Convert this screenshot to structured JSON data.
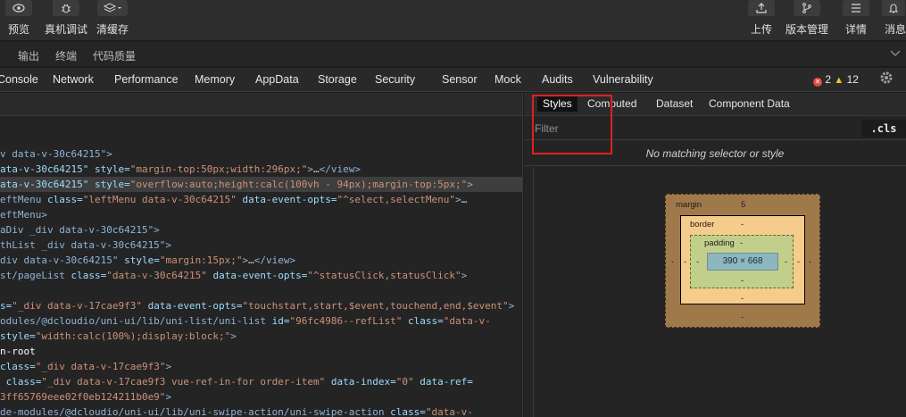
{
  "toolbar": {
    "left_buttons": [
      {
        "label": "预览",
        "icon": "eye-icon"
      },
      {
        "label": "真机调试",
        "icon": "bug-icon"
      },
      {
        "label": "清缓存",
        "icon": "layers-icon"
      }
    ],
    "right_buttons": [
      {
        "label": "上传",
        "icon": "upload-icon"
      },
      {
        "label": "版本管理",
        "icon": "branch-icon"
      },
      {
        "label": "详情",
        "icon": "menu-icon"
      },
      {
        "label": "消息",
        "icon": "bell-icon"
      }
    ]
  },
  "subtabs": [
    "输出",
    "终端",
    "代码质量"
  ],
  "devtools": {
    "tabs": [
      "Console",
      "Network",
      "Performance",
      "Memory",
      "AppData",
      "Storage",
      "Security",
      "Sensor",
      "Mock",
      "Audits",
      "Vulnerability"
    ],
    "error_count": "2",
    "warning_count": "12"
  },
  "styles_panel": {
    "tabs": [
      "Styles",
      "Computed",
      "Dataset",
      "Component Data"
    ],
    "active_tab": "Styles",
    "filter_placeholder": "Filter",
    "cls_label": ".cls",
    "no_match": "No matching selector or style"
  },
  "box_model": {
    "margin_label": "margin",
    "margin_top": "5",
    "margin_left": "-",
    "margin_right": "-",
    "margin_bottom": "-",
    "border_label": "border",
    "border_top": "-",
    "border_left": "-",
    "border_right": "-",
    "border_bottom": "-",
    "padding_label": "padding",
    "padding_top": "-",
    "padding_left": "-",
    "padding_right": "-",
    "padding_bottom": "-",
    "content": "390 × 668"
  },
  "elements": {
    "lines": [
      [
        {
          "c": "tag",
          "t": "v data-v-30c64215\">"
        }
      ],
      [
        {
          "c": "at",
          "t": "ata-v-30c64215\" "
        },
        {
          "c": "at",
          "t": "style="
        },
        {
          "c": "av",
          "t": "\"margin-top:50px;width:296px;\""
        },
        {
          "c": "tag",
          "t": ">"
        },
        {
          "c": "tx",
          "t": "…"
        },
        {
          "c": "tag",
          "t": "</view>"
        }
      ],
      [
        {
          "c": "at",
          "t": "ata-v-30c64215\" "
        },
        {
          "c": "at",
          "t": "style="
        },
        {
          "c": "av",
          "t": "\"overflow:auto;height:calc(100vh - 94px);margin-top:5px;\""
        },
        {
          "c": "tag",
          "t": ">"
        }
      ],
      [
        {
          "c": "tag",
          "t": "eftMenu "
        },
        {
          "c": "at",
          "t": "class="
        },
        {
          "c": "av",
          "t": "\"leftMenu data-v-30c64215\" "
        },
        {
          "c": "at",
          "t": "data-event-opts="
        },
        {
          "c": "av",
          "t": "\"^select,selectMenu\""
        },
        {
          "c": "tag",
          "t": ">"
        },
        {
          "c": "tx",
          "t": "…"
        }
      ],
      [
        {
          "c": "tag",
          "t": "eftMenu>"
        }
      ],
      [
        {
          "c": "tag",
          "t": "aDiv _div data-v-30c64215\">"
        }
      ],
      [
        {
          "c": "tag",
          "t": "thList _div data-v-30c64215\">"
        }
      ],
      [
        {
          "c": "tag",
          "t": "div data-v-30c64215\" "
        },
        {
          "c": "at",
          "t": "style="
        },
        {
          "c": "av",
          "t": "\"margin:15px;\""
        },
        {
          "c": "tag",
          "t": ">"
        },
        {
          "c": "tx",
          "t": "…"
        },
        {
          "c": "tag",
          "t": "</view>"
        }
      ],
      [
        {
          "c": "tag",
          "t": "st/pageList "
        },
        {
          "c": "at",
          "t": "class="
        },
        {
          "c": "av",
          "t": "\"data-v-30c64215\" "
        },
        {
          "c": "at",
          "t": "data-event-opts="
        },
        {
          "c": "av",
          "t": "\"^statusClick,statusClick\""
        },
        {
          "c": "tag",
          "t": ">"
        }
      ],
      [],
      [
        {
          "c": "at",
          "t": "s="
        },
        {
          "c": "av",
          "t": "\"_div data-v-17cae9f3\" "
        },
        {
          "c": "at",
          "t": "data-event-opts="
        },
        {
          "c": "av",
          "t": "\"touchstart,start,$event,touchend,end,$event\""
        },
        {
          "c": "tag",
          "t": ">"
        }
      ],
      [
        {
          "c": "tag",
          "t": "odules/@dcloudio/uni-ui/lib/uni-list/uni-list "
        },
        {
          "c": "at",
          "t": "id="
        },
        {
          "c": "av",
          "t": "\"96fc4986--refList\" "
        },
        {
          "c": "at",
          "t": "class="
        },
        {
          "c": "av",
          "t": "\"data-v-"
        }
      ],
      [
        {
          "c": "at",
          "t": "style="
        },
        {
          "c": "av",
          "t": "\"width:calc(100%);display:block;\""
        },
        {
          "c": "tag",
          "t": ">"
        }
      ],
      [
        {
          "c": "wh",
          "t": "n-root"
        }
      ],
      [
        {
          "c": "at",
          "t": "class="
        },
        {
          "c": "av",
          "t": "\"_div data-v-17cae9f3\""
        },
        {
          "c": "tag",
          "t": ">"
        }
      ],
      [
        {
          "c": "at",
          "t": " class="
        },
        {
          "c": "av",
          "t": "\"_div data-v-17cae9f3 vue-ref-in-for order-item\" "
        },
        {
          "c": "at",
          "t": "data-index="
        },
        {
          "c": "av",
          "t": "\"0\" "
        },
        {
          "c": "at",
          "t": "data-ref="
        }
      ],
      [
        {
          "c": "av",
          "t": "3ff65769eee02f0eb124211b0e9\""
        },
        {
          "c": "tag",
          "t": ">"
        }
      ],
      [
        {
          "c": "tag",
          "t": "de-modules/@dcloudio/uni-ui/lib/uni-swipe-action/uni-swipe-action "
        },
        {
          "c": "at",
          "t": "class="
        },
        {
          "c": "av",
          "t": "\"data-v-"
        }
      ]
    ]
  }
}
